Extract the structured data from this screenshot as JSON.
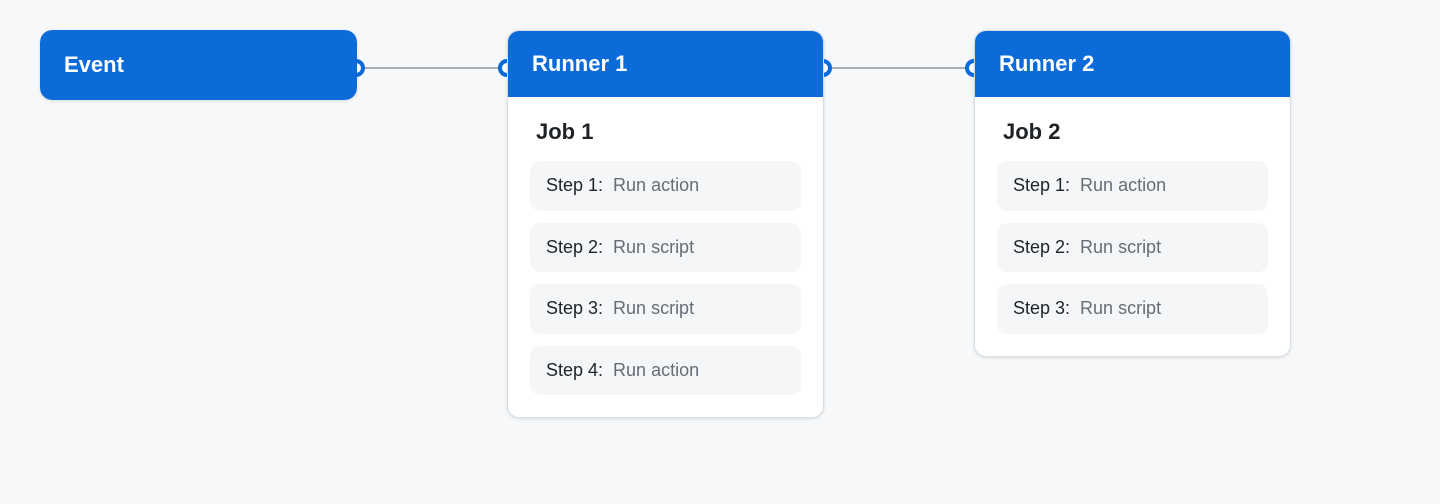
{
  "colors": {
    "accent": "#0b6bd9",
    "bg": "#f6f8fa",
    "step_bg": "#f5f6f8",
    "muted": "#656d76"
  },
  "event": {
    "title": "Event"
  },
  "runners": [
    {
      "title": "Runner 1",
      "job_title": "Job 1",
      "steps": [
        {
          "label": "Step 1:",
          "desc": "Run action"
        },
        {
          "label": "Step 2:",
          "desc": "Run script"
        },
        {
          "label": "Step 3:",
          "desc": "Run script"
        },
        {
          "label": "Step 4:",
          "desc": "Run action"
        }
      ]
    },
    {
      "title": "Runner 2",
      "job_title": "Job 2",
      "steps": [
        {
          "label": "Step 1:",
          "desc": "Run action"
        },
        {
          "label": "Step 2:",
          "desc": "Run script"
        },
        {
          "label": "Step 3:",
          "desc": "Run script"
        }
      ]
    }
  ]
}
